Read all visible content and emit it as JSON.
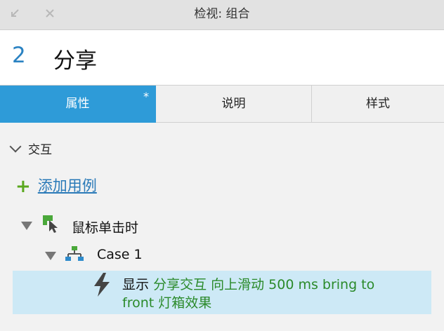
{
  "window": {
    "title": "检视: 组合",
    "minimize_icon": "arrow-diagonal-icon",
    "close_icon": "close-icon"
  },
  "header": {
    "number": "2",
    "name": "分享"
  },
  "tabs": [
    {
      "label": "属性",
      "active": true,
      "marker": "*"
    },
    {
      "label": "说明",
      "active": false
    },
    {
      "label": "样式",
      "active": false
    }
  ],
  "interactions": {
    "section_label": "交互",
    "add_case_label": "添加用例",
    "event": {
      "label": "鼠标单击时"
    },
    "case": {
      "label": "Case 1"
    },
    "action": {
      "verb": "显示",
      "detail_line1": "分享交互 向上滑动 500 ms bring to",
      "detail_line2_start": "front",
      "detail_line2_end": "灯箱效果"
    }
  },
  "colors": {
    "accent": "#2e9bd8",
    "number": "#2a82c2",
    "add_plus": "#5aa81e",
    "action_highlight": "#cde9f6",
    "action_detail": "#2a8a2a"
  }
}
